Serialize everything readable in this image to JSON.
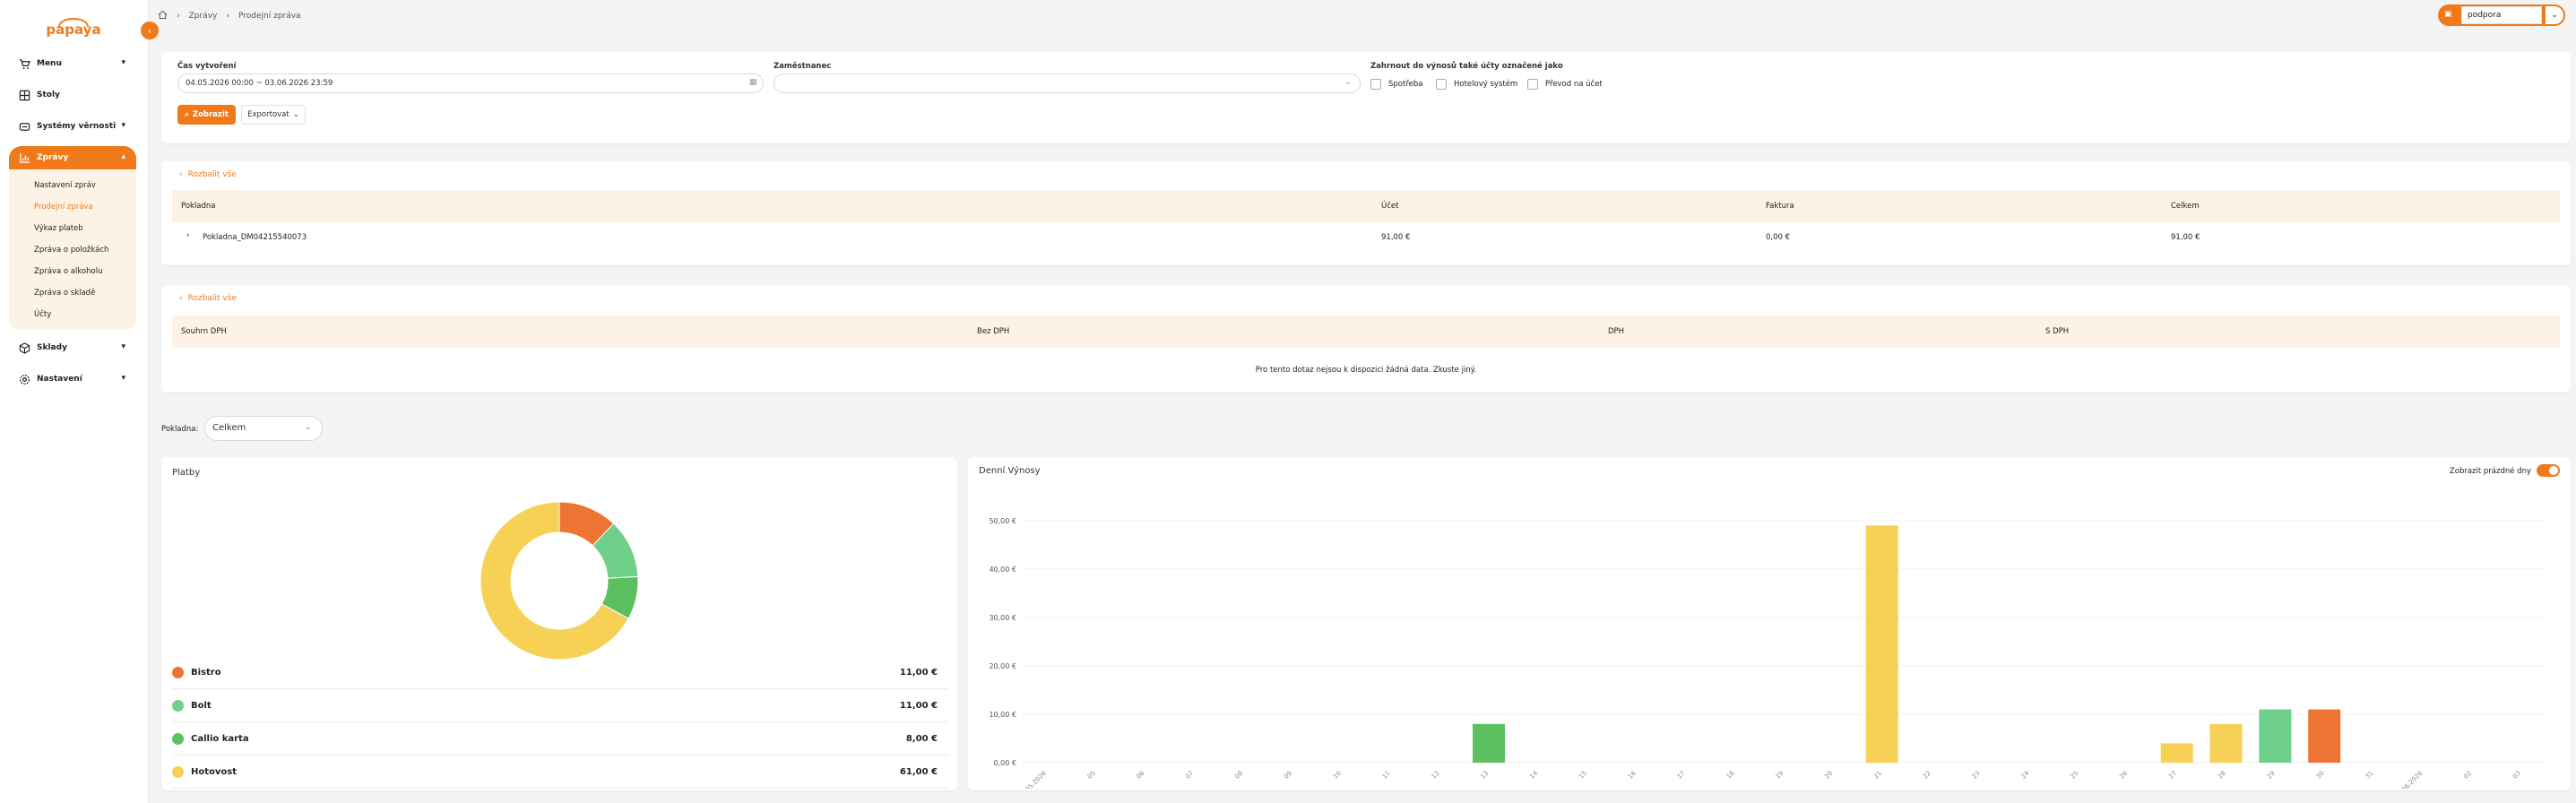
{
  "app": {
    "logo_text": "papaya",
    "collapse_icon": "chevron-left-icon"
  },
  "sidebar": {
    "items": [
      {
        "label": "Menu",
        "icon": "cart-icon",
        "chevron": "▾"
      },
      {
        "label": "Stoly",
        "icon": "grid-icon",
        "chevron": ""
      },
      {
        "label": "Systémy věrnosti",
        "icon": "group-icon",
        "chevron": "▾"
      },
      {
        "label": "Zprávy",
        "icon": "chart-icon",
        "chevron": "▴"
      },
      {
        "label": "Sklady",
        "icon": "box-icon",
        "chevron": "▾"
      },
      {
        "label": "Nastavení",
        "icon": "gear-icon",
        "chevron": "▾"
      }
    ],
    "submenu": [
      "Nastavení zpráv",
      "Prodejní zpráva",
      "Výkaz plateb",
      "Zpráva o položkách",
      "Zpráva o alkoholu",
      "Zpráva o skladě",
      "Účty"
    ],
    "submenu_current": 1
  },
  "breadcrumb": {
    "home_icon": "home-icon",
    "items": [
      "Zprávy",
      "Prodejní zpráva"
    ]
  },
  "user": {
    "name": "podpora",
    "icon": "user-icon"
  },
  "filters": {
    "created_label": "Čas vytvoření",
    "created_value": "04.05.2026 00:00 ~ 03.06.2026 23:59",
    "employee_label": "Zaměstnanec",
    "employee_value": "",
    "include_label": "Zahrnout do výnosů také účty označené jako",
    "checkboxes": [
      "Spotřeba",
      "Hotelový systém",
      "Převod na účet"
    ],
    "show_button": "Zobrazit",
    "export_button": "Exportovat"
  },
  "registers_table": {
    "expand_label": "Rozbalit vše",
    "headers": [
      "Pokladna",
      "Účet",
      "Faktura",
      "Celkem"
    ],
    "rows": [
      {
        "name": "Pokladna_DM04215540073",
        "account": "91,00 €",
        "invoice": "0,00 €",
        "total": "91,00 €"
      }
    ]
  },
  "vat_table": {
    "expand_label": "Rozbalit vše",
    "headers": [
      "Souhrn DPH",
      "Bez DPH",
      "DPH",
      "S DPH"
    ],
    "empty_message": "Pro tento dotaz nejsou k dispozici žádná data. Zkuste jiný."
  },
  "register_select": {
    "label": "Pokladna:",
    "value": "Celkem"
  },
  "payments": {
    "title": "Platby",
    "items": [
      {
        "name": "Bistro",
        "value": "11,00 €",
        "amount": 11,
        "color": "#ee7433"
      },
      {
        "name": "Bolt",
        "value": "11,00 €",
        "amount": 11,
        "color": "#6fd08c"
      },
      {
        "name": "Callio karta",
        "value": "8,00 €",
        "amount": 8,
        "color": "#5cc061"
      },
      {
        "name": "Hotovost",
        "value": "61,00 €",
        "amount": 61,
        "color": "#f7d155"
      }
    ]
  },
  "daily": {
    "title": "Denní Výnosy",
    "toggle_label": "Zobrazit prázdné dny",
    "toggle_on": true
  },
  "chart_data": [
    {
      "type": "pie",
      "title": "Platby",
      "categories": [
        "Bistro",
        "Bolt",
        "Callio karta",
        "Hotovost"
      ],
      "values": [
        11,
        11,
        8,
        61
      ],
      "colors": [
        "#ee7433",
        "#6fd08c",
        "#5cc061",
        "#f7d155"
      ]
    },
    {
      "type": "bar",
      "title": "Denní Výnosy",
      "ylim": [
        0,
        50
      ],
      "yticks": [
        "0,00 €",
        "10,00 €",
        "20,00 €",
        "30,00 €",
        "40,00 €",
        "50,00 €"
      ],
      "categories": [
        "04.05.2026",
        "05",
        "06",
        "07",
        "08",
        "09",
        "10",
        "11",
        "12",
        "13",
        "14",
        "15",
        "16",
        "17",
        "18",
        "19",
        "20",
        "21",
        "22",
        "23",
        "24",
        "25",
        "26",
        "27",
        "28",
        "29",
        "30",
        "31",
        "01.06.2026",
        "02",
        "03"
      ],
      "values": [
        0,
        0,
        0,
        0,
        0,
        0,
        0,
        0,
        0,
        8,
        0,
        0,
        0,
        0,
        0,
        0,
        0,
        49,
        0,
        0,
        0,
        0,
        0,
        4,
        8,
        11,
        11,
        0,
        0,
        0,
        0
      ],
      "colors": [
        "#f7d155",
        "#f7d155",
        "#f7d155",
        "#f7d155",
        "#f7d155",
        "#f7d155",
        "#f7d155",
        "#f7d155",
        "#f7d155",
        "#5cc061",
        "#f7d155",
        "#f7d155",
        "#f7d155",
        "#f7d155",
        "#f7d155",
        "#f7d155",
        "#f7d155",
        "#f7d155",
        "#f7d155",
        "#f7d155",
        "#f7d155",
        "#f7d155",
        "#f7d155",
        "#f7d155",
        "#f7d155",
        "#6fd08c",
        "#ee7433",
        "#f7d155",
        "#f7d155",
        "#f7d155",
        "#f7d155"
      ]
    }
  ]
}
